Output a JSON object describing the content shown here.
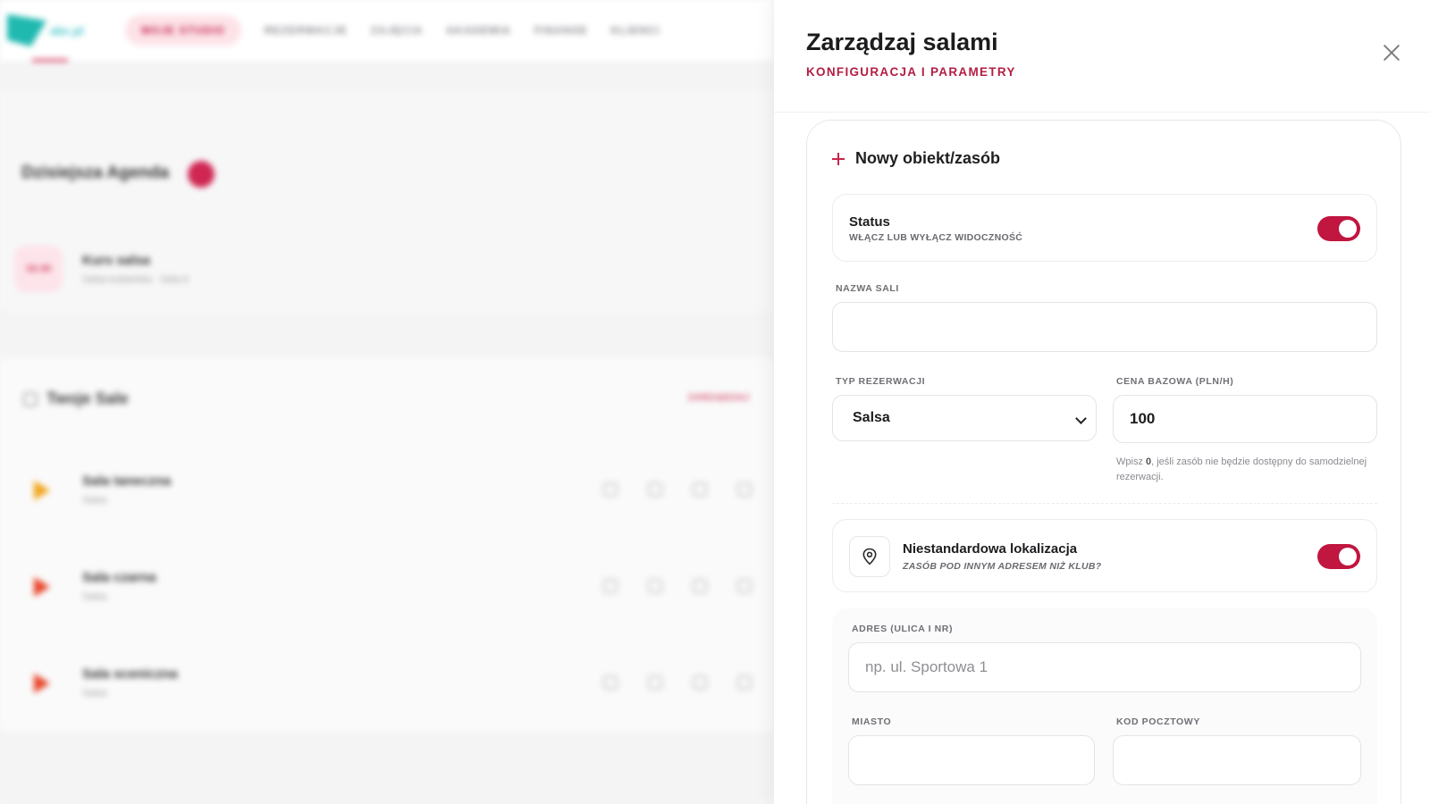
{
  "background": {
    "logo_text": "abc.pl",
    "nav": [
      "MOJE STUDIO",
      "REZERWACJE",
      "ZAJĘCIA",
      "AKADEMIA",
      "FINANSE",
      "KLIENCI"
    ],
    "agenda": {
      "title": "Dzisiejsza Agenda",
      "item_time": "16:30",
      "item_name": "Kurs salsa",
      "item_sub": "Salsa kubańska · Sala A"
    },
    "halls": {
      "title": "Twoje Sale",
      "link": "ZARZĄDZAJ",
      "items": [
        {
          "name": "Sala taneczna",
          "sub": "Salsa"
        },
        {
          "name": "Sala czarna",
          "sub": "Salsa"
        },
        {
          "name": "Sala sceniczna",
          "sub": "Salsa"
        }
      ]
    }
  },
  "drawer": {
    "title": "Zarządzaj salami",
    "subtitle": "KONFIGURACJA I PARAMETRY",
    "form_title": "Nowy obiekt/zasób",
    "status": {
      "title": "Status",
      "subtitle": "WŁĄCZ LUB WYŁĄCZ WIDOCZNOŚĆ",
      "enabled": true
    },
    "name_label": "NAZWA SALI",
    "name_value": "",
    "type_label": "TYP REZERWACJI",
    "type_value": "Salsa",
    "price_label": "CENA BAZOWA (PLN/H)",
    "price_value": "100",
    "hint_pre": "Wpisz ",
    "hint_bold": "0",
    "hint_post": ", jeśli zasób nie będzie dostępny do samodzielnej rezerwacji.",
    "location": {
      "title": "Niestandardowa lokalizacja",
      "subtitle": "ZASÓB POD INNYM ADRESEM NIŻ KLUB?",
      "enabled": true
    },
    "address_label": "ADRES (ULICA I NR)",
    "address_placeholder": "np. ul. Sportowa 1",
    "city_label": "MIASTO",
    "postal_label": "KOD POCZTOWY"
  },
  "colors": {
    "accent": "#c0163f",
    "accent_text": "#b21e43"
  },
  "icons": [
    "close-icon",
    "plus-icon",
    "map-pin-icon",
    "chevron-down-icon"
  ]
}
